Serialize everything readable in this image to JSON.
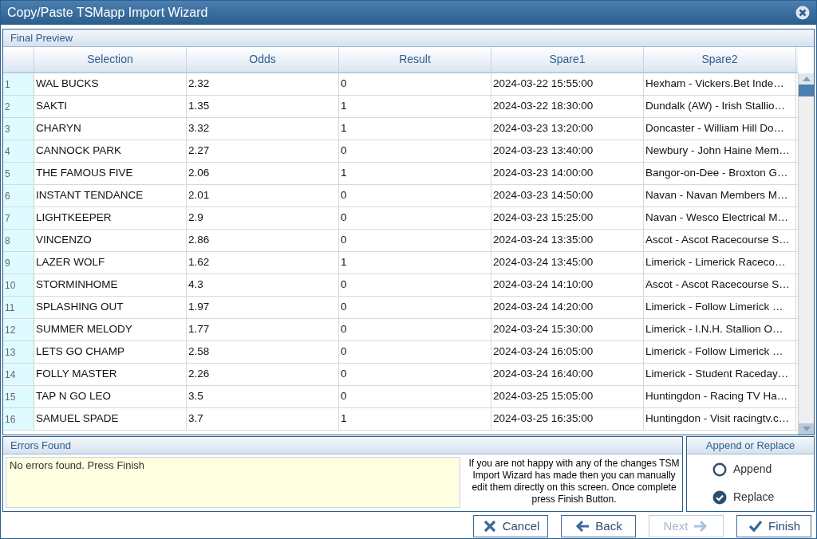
{
  "window": {
    "title": "Copy/Paste TSMapp Import Wizard"
  },
  "preview": {
    "title": "Final Preview",
    "columns": [
      "Selection",
      "Odds",
      "Result",
      "Spare1",
      "Spare2"
    ],
    "rows": [
      {
        "number": "1",
        "cells": [
          "WAL BUCKS",
          "2.32",
          "0",
          "2024-03-22 15:55:00",
          "Hexham - Vickers.Bet Inde…"
        ]
      },
      {
        "number": "2",
        "cells": [
          "SAKTI",
          "1.35",
          "1",
          "2024-03-22 18:30:00",
          "Dundalk (AW) - Irish Stallio…"
        ]
      },
      {
        "number": "3",
        "cells": [
          "CHARYN",
          "3.32",
          "1",
          "2024-03-23 13:20:00",
          "Doncaster - William Hill Do…"
        ]
      },
      {
        "number": "4",
        "cells": [
          "CANNOCK PARK",
          "2.27",
          "0",
          "2024-03-23 13:40:00",
          "Newbury - John Haine Mem…"
        ]
      },
      {
        "number": "5",
        "cells": [
          "THE FAMOUS FIVE",
          "2.06",
          "1",
          "2024-03-23 14:00:00",
          "Bangor-on-Dee - Broxton G…"
        ]
      },
      {
        "number": "6",
        "cells": [
          "INSTANT TENDANCE",
          "2.01",
          "0",
          "2024-03-23 14:50:00",
          "Navan - Navan Members M…"
        ]
      },
      {
        "number": "7",
        "cells": [
          "LIGHTKEEPER",
          "2.9",
          "0",
          "2024-03-23 15:25:00",
          "Navan - Wesco Electrical M…"
        ]
      },
      {
        "number": "8",
        "cells": [
          "VINCENZO",
          "2.86",
          "0",
          "2024-03-24 13:35:00",
          "Ascot - Ascot Racecourse S…"
        ]
      },
      {
        "number": "9",
        "cells": [
          "LAZER WOLF",
          "1.62",
          "1",
          "2024-03-24 13:45:00",
          "Limerick - Limerick Raceco…"
        ]
      },
      {
        "number": "10",
        "cells": [
          "STORMINHOME",
          "4.3",
          "0",
          "2024-03-24 14:10:00",
          "Ascot - Ascot Racecourse S…"
        ]
      },
      {
        "number": "11",
        "cells": [
          "SPLASHING OUT",
          "1.97",
          "0",
          "2024-03-24 14:20:00",
          "Limerick - Follow Limerick …"
        ]
      },
      {
        "number": "12",
        "cells": [
          "SUMMER MELODY",
          "1.77",
          "0",
          "2024-03-24 15:30:00",
          "Limerick - I.N.H. Stallion O…"
        ]
      },
      {
        "number": "13",
        "cells": [
          "LETS GO CHAMP",
          "2.58",
          "0",
          "2024-03-24 16:05:00",
          "Limerick - Follow Limerick …"
        ]
      },
      {
        "number": "14",
        "cells": [
          "FOLLY MASTER",
          "2.26",
          "0",
          "2024-03-24 16:40:00",
          "Limerick - Student Raceday…"
        ]
      },
      {
        "number": "15",
        "cells": [
          "TAP N GO LEO",
          "3.5",
          "0",
          "2024-03-25 15:05:00",
          "Huntingdon - Racing TV Ha…"
        ]
      },
      {
        "number": "16",
        "cells": [
          "SAMUEL SPADE",
          "3.7",
          "1",
          "2024-03-25 16:35:00",
          "Huntingdon - Visit racingtv.c…"
        ]
      }
    ]
  },
  "errors": {
    "title": "Errors Found",
    "message": "No errors found. Press Finish",
    "hint": "If you are not happy with any of the changes TSM Import Wizard has made then you can manually edit them directly on this screen. Once complete press Finish Button."
  },
  "mode": {
    "title": "Append or Replace",
    "options": [
      {
        "label": "Append",
        "selected": false
      },
      {
        "label": "Replace",
        "selected": true
      }
    ]
  },
  "buttons": [
    {
      "kind": "cancel",
      "label": "Cancel",
      "disabled": false
    },
    {
      "kind": "back",
      "label": "Back",
      "disabled": false
    },
    {
      "kind": "next",
      "label": "Next",
      "disabled": true
    },
    {
      "kind": "finish",
      "label": "Finish",
      "disabled": false
    }
  ]
}
